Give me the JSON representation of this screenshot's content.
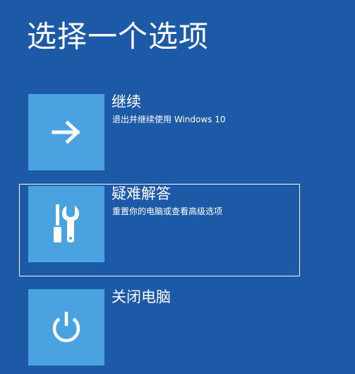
{
  "screen": {
    "title": "选择一个选项"
  },
  "options": [
    {
      "label": "继续",
      "description": "退出并继续使用 Windows 10",
      "icon": "arrow-right-icon",
      "selected": false
    },
    {
      "label": "疑难解答",
      "description": "重置你的电脑或查看高级选项",
      "icon": "tools-icon",
      "selected": true
    },
    {
      "label": "关闭电脑",
      "description": "",
      "icon": "power-icon",
      "selected": false
    }
  ],
  "colors": {
    "background": "#1c5aa8",
    "tile": "#4aa3e0",
    "text": "#ffffff",
    "selection_border": "#ffffff"
  }
}
